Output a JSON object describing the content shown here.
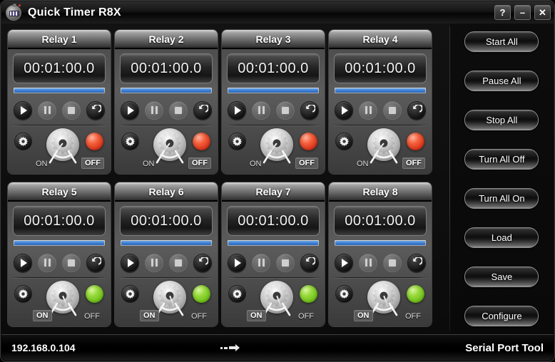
{
  "window": {
    "title": "Quick Timer R8X",
    "app_icon": "stopwatch-icon",
    "controls": [
      {
        "name": "help-button",
        "label": "?"
      },
      {
        "name": "minimize-button",
        "label": "–"
      },
      {
        "name": "close-button",
        "label": "✕"
      }
    ]
  },
  "colors": {
    "led_off": "#f4603c",
    "led_on": "#96d93c",
    "progress": "#3d7fd4",
    "panel_bg": "#525252",
    "window_bg": "#0b0b0b"
  },
  "relays": [
    {
      "title": "Relay 1",
      "timer": "00:01:00.0",
      "progress_percent": 100,
      "play_enabled": true,
      "pause_enabled": false,
      "stop_enabled": false,
      "reset_enabled": true,
      "on_label": "ON",
      "off_label": "OFF",
      "state": "OFF",
      "led": "red",
      "knob_angle": 38
    },
    {
      "title": "Relay 2",
      "timer": "00:01:00.0",
      "progress_percent": 100,
      "play_enabled": true,
      "pause_enabled": false,
      "stop_enabled": false,
      "reset_enabled": true,
      "on_label": "ON",
      "off_label": "OFF",
      "state": "OFF",
      "led": "red",
      "knob_angle": 38
    },
    {
      "title": "Relay 3",
      "timer": "00:01:00.0",
      "progress_percent": 100,
      "play_enabled": true,
      "pause_enabled": false,
      "stop_enabled": false,
      "reset_enabled": true,
      "on_label": "ON",
      "off_label": "OFF",
      "state": "OFF",
      "led": "red",
      "knob_angle": 38
    },
    {
      "title": "Relay 4",
      "timer": "00:01:00.0",
      "progress_percent": 100,
      "play_enabled": true,
      "pause_enabled": false,
      "stop_enabled": false,
      "reset_enabled": true,
      "on_label": "ON",
      "off_label": "OFF",
      "state": "OFF",
      "led": "red",
      "knob_angle": 38
    },
    {
      "title": "Relay 5",
      "timer": "00:01:00.0",
      "progress_percent": 100,
      "play_enabled": true,
      "pause_enabled": false,
      "stop_enabled": false,
      "reset_enabled": true,
      "on_label": "ON",
      "off_label": "OFF",
      "state": "ON",
      "led": "green",
      "knob_angle": -22
    },
    {
      "title": "Relay 6",
      "timer": "00:01:00.0",
      "progress_percent": 100,
      "play_enabled": true,
      "pause_enabled": false,
      "stop_enabled": false,
      "reset_enabled": true,
      "on_label": "ON",
      "off_label": "OFF",
      "state": "ON",
      "led": "green",
      "knob_angle": -22
    },
    {
      "title": "Relay 7",
      "timer": "00:01:00.0",
      "progress_percent": 100,
      "play_enabled": true,
      "pause_enabled": false,
      "stop_enabled": false,
      "reset_enabled": true,
      "on_label": "ON",
      "off_label": "OFF",
      "state": "ON",
      "led": "green",
      "knob_angle": -22
    },
    {
      "title": "Relay 8",
      "timer": "00:01:00.0",
      "progress_percent": 100,
      "play_enabled": true,
      "pause_enabled": false,
      "stop_enabled": false,
      "reset_enabled": true,
      "on_label": "ON",
      "off_label": "OFF",
      "state": "ON",
      "led": "green",
      "knob_angle": -22
    }
  ],
  "relay_icons": {
    "play": "play-icon",
    "pause": "pause-icon",
    "stop": "stop-icon",
    "reset": "reset-icon",
    "settings": "gear-icon",
    "knob": "rotary-knob",
    "led": "status-led"
  },
  "side_buttons": [
    {
      "name": "start-all-button",
      "label": "Start All"
    },
    {
      "name": "pause-all-button",
      "label": "Pause All"
    },
    {
      "name": "stop-all-button",
      "label": "Stop All"
    },
    {
      "name": "turn-all-off-button",
      "label": "Turn All Off"
    },
    {
      "name": "turn-all-on-button",
      "label": "Turn All On"
    },
    {
      "name": "load-button",
      "label": "Load"
    },
    {
      "name": "save-button",
      "label": "Save"
    },
    {
      "name": "configure-button",
      "label": "Configure"
    }
  ],
  "statusbar": {
    "ip_address": "192.168.0.104",
    "connection_icon": "data-transfer-arrow-icon",
    "tool_name": "Serial Port Tool"
  }
}
